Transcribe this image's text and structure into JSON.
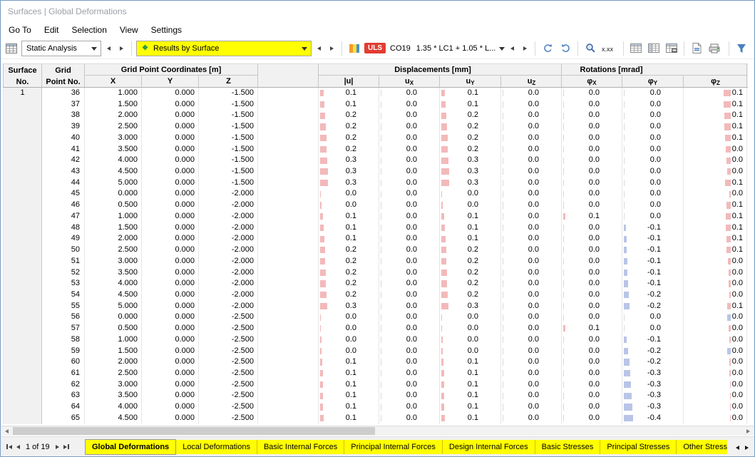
{
  "window": {
    "title": "Surfaces | Global Deformations"
  },
  "menu": {
    "items": [
      "Go To",
      "Edit",
      "Selection",
      "View",
      "Settings"
    ]
  },
  "toolbar": {
    "analysis": "Static Analysis",
    "results": "Results by Surface",
    "uls": "ULS",
    "co": "CO19",
    "formula": "1.35 * LC1 + 1.05 * L...",
    "overflow": "»"
  },
  "colors": {
    "highlight": "#ffff00",
    "bar_positive": "#f3b9ba",
    "bar_negative": "#b9c5e8",
    "uls_badge": "#e23d32"
  },
  "table": {
    "surface_no": "1",
    "header": {
      "surface_l1": "Surface",
      "surface_l2": "No.",
      "grid_l1": "Grid",
      "grid_l2": "Point No.",
      "grp_coords": "Grid Point Coordinates [m]",
      "grp_disp": "Displacements [mm]",
      "grp_rot": "Rotations [mrad]",
      "col_x": "X",
      "col_y": "Y",
      "col_z": "Z",
      "col_u": "|u|",
      "col_ux_m": "u",
      "col_ux_s": "X",
      "col_uy_m": "u",
      "col_uy_s": "Y",
      "col_uz_m": "u",
      "col_uz_s": "Z",
      "col_phix_m": "φ",
      "col_phix_s": "X",
      "col_phiy_m": "φ",
      "col_phiy_s": "Y",
      "col_phiz_m": "φ",
      "col_phiz_s": "Z"
    },
    "rows": [
      {
        "no": "36",
        "x": "1.000",
        "y": "0.000",
        "z": "-1.500",
        "u": "0.1",
        "ux": "0.0",
        "uy": "0.1",
        "uz": "0.0",
        "px": "0.0",
        "py": "0.0",
        "pz": "0.1",
        "bu": 5,
        "buy": 5,
        "bpx": 0,
        "bpy": 0,
        "bpz": 10,
        "pzneg": false
      },
      {
        "no": "37",
        "x": "1.500",
        "y": "0.000",
        "z": "-1.500",
        "u": "0.1",
        "ux": "0.0",
        "uy": "0.1",
        "uz": "0.0",
        "px": "0.0",
        "py": "0.0",
        "pz": "0.1",
        "bu": 6,
        "buy": 6,
        "bpx": 0,
        "bpy": 0,
        "bpz": 10,
        "pzneg": false
      },
      {
        "no": "38",
        "x": "2.000",
        "y": "0.000",
        "z": "-1.500",
        "u": "0.2",
        "ux": "0.0",
        "uy": "0.2",
        "uz": "0.0",
        "px": "0.0",
        "py": "0.0",
        "pz": "0.1",
        "bu": 7,
        "buy": 7,
        "bpx": 0,
        "bpy": 0,
        "bpz": 9,
        "pzneg": false
      },
      {
        "no": "39",
        "x": "2.500",
        "y": "0.000",
        "z": "-1.500",
        "u": "0.2",
        "ux": "0.0",
        "uy": "0.2",
        "uz": "0.0",
        "px": "0.0",
        "py": "0.0",
        "pz": "0.1",
        "bu": 8,
        "buy": 8,
        "bpx": 0,
        "bpy": 0,
        "bpz": 9,
        "pzneg": false
      },
      {
        "no": "40",
        "x": "3.000",
        "y": "0.000",
        "z": "-1.500",
        "u": "0.2",
        "ux": "0.0",
        "uy": "0.2",
        "uz": "0.0",
        "px": "0.0",
        "py": "0.0",
        "pz": "0.1",
        "bu": 9,
        "buy": 9,
        "bpx": 0,
        "bpy": 0,
        "bpz": 8,
        "pzneg": false
      },
      {
        "no": "41",
        "x": "3.500",
        "y": "0.000",
        "z": "-1.500",
        "u": "0.2",
        "ux": "0.0",
        "uy": "0.2",
        "uz": "0.0",
        "px": "0.0",
        "py": "0.0",
        "pz": "0.0",
        "bu": 9,
        "buy": 9,
        "bpx": 0,
        "bpy": 0,
        "bpz": 7,
        "pzneg": false
      },
      {
        "no": "42",
        "x": "4.000",
        "y": "0.000",
        "z": "-1.500",
        "u": "0.3",
        "ux": "0.0",
        "uy": "0.3",
        "uz": "0.0",
        "px": "0.0",
        "py": "0.0",
        "pz": "0.0",
        "bu": 10,
        "buy": 10,
        "bpx": 0,
        "bpy": 0,
        "bpz": 6,
        "pzneg": false
      },
      {
        "no": "43",
        "x": "4.500",
        "y": "0.000",
        "z": "-1.500",
        "u": "0.3",
        "ux": "0.0",
        "uy": "0.3",
        "uz": "0.0",
        "px": "0.0",
        "py": "0.0",
        "pz": "0.0",
        "bu": 11,
        "buy": 11,
        "bpx": 0,
        "bpy": 0,
        "bpz": 5,
        "pzneg": false
      },
      {
        "no": "44",
        "x": "5.000",
        "y": "0.000",
        "z": "-1.500",
        "u": "0.3",
        "ux": "0.0",
        "uy": "0.3",
        "uz": "0.0",
        "px": "0.0",
        "py": "0.0",
        "pz": "0.1",
        "bu": 11,
        "buy": 11,
        "bpx": 0,
        "bpy": 0,
        "bpz": 8,
        "pzneg": false
      },
      {
        "no": "45",
        "x": "0.000",
        "y": "0.000",
        "z": "-2.000",
        "u": "0.0",
        "ux": "0.0",
        "uy": "0.0",
        "uz": "0.0",
        "px": "0.0",
        "py": "0.0",
        "pz": "0.0",
        "bu": 1,
        "buy": 1,
        "bpx": 0,
        "bpy": 0,
        "bpz": 2,
        "pzneg": false
      },
      {
        "no": "46",
        "x": "0.500",
        "y": "0.000",
        "z": "-2.000",
        "u": "0.0",
        "ux": "0.0",
        "uy": "0.0",
        "uz": "0.0",
        "px": "0.0",
        "py": "0.0",
        "pz": "0.1",
        "bu": 2,
        "buy": 2,
        "bpx": 0,
        "bpy": 0,
        "bpz": 6,
        "pzneg": false
      },
      {
        "no": "47",
        "x": "1.000",
        "y": "0.000",
        "z": "-2.000",
        "u": "0.1",
        "ux": "0.0",
        "uy": "0.1",
        "uz": "0.0",
        "px": "0.1",
        "py": "0.0",
        "pz": "0.1",
        "bu": 4,
        "buy": 4,
        "bpx": 3,
        "bpy": 0,
        "bpz": 7,
        "pzneg": false
      },
      {
        "no": "48",
        "x": "1.500",
        "y": "0.000",
        "z": "-2.000",
        "u": "0.1",
        "ux": "0.0",
        "uy": "0.1",
        "uz": "0.0",
        "px": "0.0",
        "py": "-0.1",
        "pz": "0.1",
        "bu": 5,
        "buy": 5,
        "bpx": 0,
        "bpy": 3,
        "bpz": 7,
        "pzneg": false
      },
      {
        "no": "49",
        "x": "2.000",
        "y": "0.000",
        "z": "-2.000",
        "u": "0.1",
        "ux": "0.0",
        "uy": "0.1",
        "uz": "0.0",
        "px": "0.0",
        "py": "-0.1",
        "pz": "0.1",
        "bu": 6,
        "buy": 6,
        "bpx": 0,
        "bpy": 4,
        "bpz": 6,
        "pzneg": false
      },
      {
        "no": "50",
        "x": "2.500",
        "y": "0.000",
        "z": "-2.000",
        "u": "0.2",
        "ux": "0.0",
        "uy": "0.2",
        "uz": "0.0",
        "px": "0.0",
        "py": "-0.1",
        "pz": "0.1",
        "bu": 7,
        "buy": 7,
        "bpx": 0,
        "bpy": 4,
        "bpz": 6,
        "pzneg": false
      },
      {
        "no": "51",
        "x": "3.000",
        "y": "0.000",
        "z": "-2.000",
        "u": "0.2",
        "ux": "0.0",
        "uy": "0.2",
        "uz": "0.0",
        "px": "0.0",
        "py": "-0.1",
        "pz": "0.0",
        "bu": 7,
        "buy": 7,
        "bpx": 0,
        "bpy": 5,
        "bpz": 4,
        "pzneg": false
      },
      {
        "no": "52",
        "x": "3.500",
        "y": "0.000",
        "z": "-2.000",
        "u": "0.2",
        "ux": "0.0",
        "uy": "0.2",
        "uz": "0.0",
        "px": "0.0",
        "py": "-0.1",
        "pz": "0.0",
        "bu": 8,
        "buy": 8,
        "bpx": 0,
        "bpy": 5,
        "bpz": 3,
        "pzneg": false
      },
      {
        "no": "53",
        "x": "4.000",
        "y": "0.000",
        "z": "-2.000",
        "u": "0.2",
        "ux": "0.0",
        "uy": "0.2",
        "uz": "0.0",
        "px": "0.0",
        "py": "-0.1",
        "pz": "0.0",
        "bu": 8,
        "buy": 8,
        "bpx": 0,
        "bpy": 6,
        "bpz": 3,
        "pzneg": false
      },
      {
        "no": "54",
        "x": "4.500",
        "y": "0.000",
        "z": "-2.000",
        "u": "0.2",
        "ux": "0.0",
        "uy": "0.2",
        "uz": "0.0",
        "px": "0.0",
        "py": "-0.2",
        "pz": "0.0",
        "bu": 9,
        "buy": 9,
        "bpx": 0,
        "bpy": 7,
        "bpz": 2,
        "pzneg": false
      },
      {
        "no": "55",
        "x": "5.000",
        "y": "0.000",
        "z": "-2.000",
        "u": "0.3",
        "ux": "0.0",
        "uy": "0.3",
        "uz": "0.0",
        "px": "0.0",
        "py": "-0.2",
        "pz": "0.1",
        "bu": 10,
        "buy": 10,
        "bpx": 0,
        "bpy": 8,
        "bpz": 5,
        "pzneg": false
      },
      {
        "no": "56",
        "x": "0.000",
        "y": "0.000",
        "z": "-2.500",
        "u": "0.0",
        "ux": "0.0",
        "uy": "0.0",
        "uz": "0.0",
        "px": "0.0",
        "py": "0.0",
        "pz": "0.0",
        "bu": 1,
        "buy": 1,
        "bpx": 0,
        "bpy": 0,
        "bpz": 5,
        "pzneg": true
      },
      {
        "no": "57",
        "x": "0.500",
        "y": "0.000",
        "z": "-2.500",
        "u": "0.0",
        "ux": "0.0",
        "uy": "0.0",
        "uz": "0.0",
        "px": "0.1",
        "py": "0.0",
        "pz": "0.0",
        "bu": 1,
        "buy": 1,
        "bpx": 3,
        "bpy": 0,
        "bpz": 3,
        "pzneg": false
      },
      {
        "no": "58",
        "x": "1.000",
        "y": "0.000",
        "z": "-2.500",
        "u": "0.0",
        "ux": "0.0",
        "uy": "0.0",
        "uz": "0.0",
        "px": "0.0",
        "py": "-0.1",
        "pz": "0.0",
        "bu": 2,
        "buy": 2,
        "bpx": 0,
        "bpy": 4,
        "bpz": 2,
        "pzneg": false
      },
      {
        "no": "59",
        "x": "1.500",
        "y": "0.000",
        "z": "-2.500",
        "u": "0.0",
        "ux": "0.0",
        "uy": "0.0",
        "uz": "0.0",
        "px": "0.0",
        "py": "-0.2",
        "pz": "0.0",
        "bu": 2,
        "buy": 2,
        "bpx": 0,
        "bpy": 6,
        "bpz": 5,
        "pzneg": true
      },
      {
        "no": "60",
        "x": "2.000",
        "y": "0.000",
        "z": "-2.500",
        "u": "0.1",
        "ux": "0.0",
        "uy": "0.1",
        "uz": "0.0",
        "px": "0.0",
        "py": "-0.2",
        "pz": "0.0",
        "bu": 3,
        "buy": 3,
        "bpx": 0,
        "bpy": 8,
        "bpz": 2,
        "pzneg": false
      },
      {
        "no": "61",
        "x": "2.500",
        "y": "0.000",
        "z": "-2.500",
        "u": "0.1",
        "ux": "0.0",
        "uy": "0.1",
        "uz": "0.0",
        "px": "0.0",
        "py": "-0.3",
        "pz": "0.0",
        "bu": 4,
        "buy": 4,
        "bpx": 0,
        "bpy": 9,
        "bpz": 2,
        "pzneg": false
      },
      {
        "no": "62",
        "x": "3.000",
        "y": "0.000",
        "z": "-2.500",
        "u": "0.1",
        "ux": "0.0",
        "uy": "0.1",
        "uz": "0.0",
        "px": "0.0",
        "py": "-0.3",
        "pz": "0.0",
        "bu": 4,
        "buy": 4,
        "bpx": 0,
        "bpy": 10,
        "bpz": 1,
        "pzneg": false
      },
      {
        "no": "63",
        "x": "3.500",
        "y": "0.000",
        "z": "-2.500",
        "u": "0.1",
        "ux": "0.0",
        "uy": "0.1",
        "uz": "0.0",
        "px": "0.0",
        "py": "-0.3",
        "pz": "0.0",
        "bu": 4,
        "buy": 4,
        "bpx": 0,
        "bpy": 11,
        "bpz": 1,
        "pzneg": false
      },
      {
        "no": "64",
        "x": "4.000",
        "y": "0.000",
        "z": "-2.500",
        "u": "0.1",
        "ux": "0.0",
        "uy": "0.1",
        "uz": "0.0",
        "px": "0.0",
        "py": "-0.3",
        "pz": "0.0",
        "bu": 4,
        "buy": 4,
        "bpx": 0,
        "bpy": 12,
        "bpz": 1,
        "pzneg": false
      },
      {
        "no": "65",
        "x": "4.500",
        "y": "0.000",
        "z": "-2.500",
        "u": "0.1",
        "ux": "0.0",
        "uy": "0.1",
        "uz": "0.0",
        "px": "0.0",
        "py": "-0.4",
        "pz": "0.0",
        "bu": 5,
        "buy": 5,
        "bpx": 0,
        "bpy": 13,
        "bpz": 1,
        "pzneg": false
      }
    ]
  },
  "footer": {
    "pager": "1 of 19",
    "active_tab": 0,
    "tabs": [
      "Global Deformations",
      "Local Deformations",
      "Basic Internal Forces",
      "Principal Internal Forces",
      "Design Internal Forces",
      "Basic Stresses",
      "Principal Stresses",
      "Other Stresses"
    ]
  }
}
